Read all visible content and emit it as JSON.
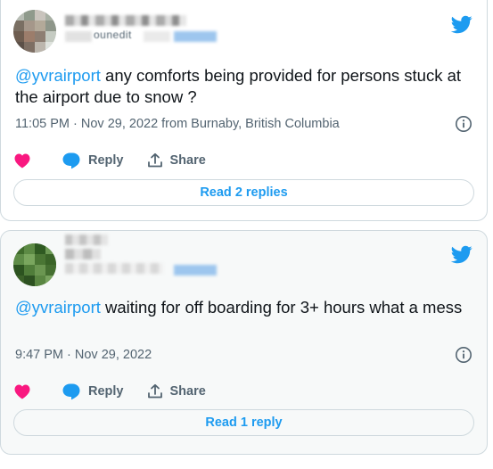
{
  "tweets": [
    {
      "handle_fragment": "ounedit",
      "mention": "@yvrairport",
      "text": " any comforts being provided for persons stuck at the airport due to snow ?",
      "meta": "11:05 PM · Nov 29, 2022 from Burnaby, British Columbia",
      "reply_label": "Reply",
      "share_label": "Share",
      "replies_button": "Read 2 replies"
    },
    {
      "mention": "@yvrairport",
      "text": " waiting for off boarding for 3+ hours what a mess",
      "meta": "9:47 PM · Nov 29, 2022",
      "reply_label": "Reply",
      "share_label": "Share",
      "replies_button": "Read 1 reply"
    }
  ],
  "icons": {
    "brand": "twitter-bird-icon",
    "like": "heart-icon",
    "reply": "speech-bubble-icon",
    "share": "share-upload-icon",
    "info": "info-circle-icon"
  },
  "colors": {
    "brand_blue": "#1d9bf0",
    "like_pink": "#f91880",
    "muted": "#536471",
    "border": "#cfd9de"
  }
}
